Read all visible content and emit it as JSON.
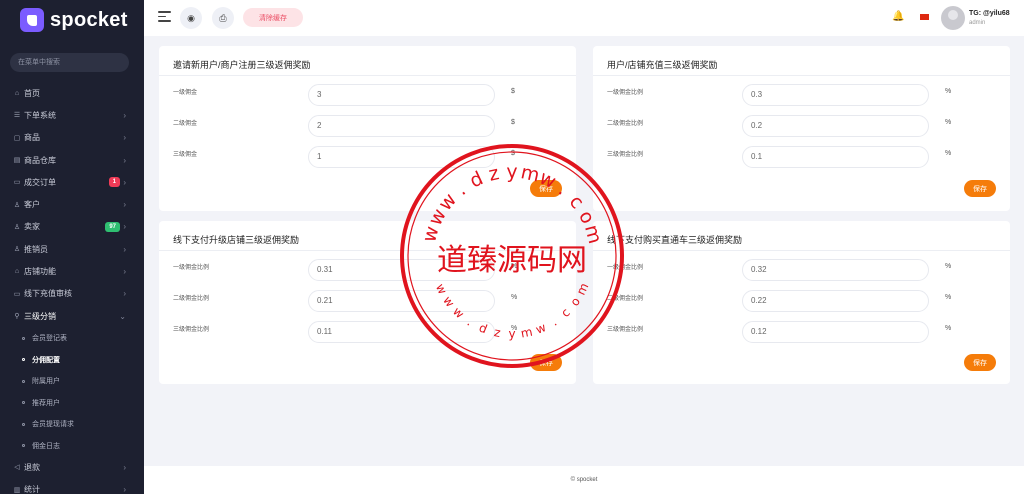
{
  "brand": {
    "name": "spocket"
  },
  "sidebar": {
    "search_placeholder": "在菜单中搜索",
    "items": [
      {
        "icon": "home-icon",
        "label": "首页",
        "chevron": false
      },
      {
        "icon": "list-icon",
        "label": "下单系统",
        "chevron": true
      },
      {
        "icon": "bag-icon",
        "label": "商品",
        "chevron": true
      },
      {
        "icon": "warehouse-icon",
        "label": "商品仓库",
        "chevron": true
      },
      {
        "icon": "order-icon",
        "label": "成交订单",
        "chevron": true,
        "badge": "1",
        "badge_color": "#ef3b57"
      },
      {
        "icon": "user-icon",
        "label": "客户",
        "chevron": true
      },
      {
        "icon": "seller-icon",
        "label": "卖家",
        "chevron": true,
        "badge": "97",
        "badge_color": "#2fbf71"
      },
      {
        "icon": "promoter-icon",
        "label": "推销员",
        "chevron": true
      },
      {
        "icon": "shop-icon",
        "label": "店铺功能",
        "chevron": true
      },
      {
        "icon": "recharge-icon",
        "label": "线下充值审核",
        "chevron": true
      },
      {
        "icon": "share-icon",
        "label": "三级分销",
        "chevron": true,
        "open": true
      }
    ],
    "subitems": [
      "会员登记表",
      "分佣配置",
      "附属用户",
      "推荐用户",
      "会员提现请求",
      "佣金日志"
    ],
    "active_sub": "分佣配置",
    "after_items": [
      {
        "icon": "refund-icon",
        "label": "退款",
        "chevron": true
      },
      {
        "icon": "stats-icon",
        "label": "统计",
        "chevron": true
      }
    ]
  },
  "topbar": {
    "clear_cache": "清除缓存",
    "user": "TG: @yilu68",
    "role": "admin"
  },
  "cards": [
    {
      "title": "邀请新用户/商户注册三级返佣奖励",
      "rows": [
        {
          "label": "一级佣金",
          "value": "3",
          "unit": "$"
        },
        {
          "label": "二级佣金",
          "value": "2",
          "unit": "$"
        },
        {
          "label": "三级佣金",
          "value": "1",
          "unit": "$"
        }
      ],
      "save": "保存"
    },
    {
      "title": "用户/店铺充值三级返佣奖励",
      "rows": [
        {
          "label": "一级佣金比例",
          "value": "0.3",
          "unit": "%"
        },
        {
          "label": "二级佣金比例",
          "value": "0.2",
          "unit": "%"
        },
        {
          "label": "三级佣金比例",
          "value": "0.1",
          "unit": "%"
        }
      ],
      "save": "保存"
    },
    {
      "title": "线下支付升级店铺三级返佣奖励",
      "rows": [
        {
          "label": "一级佣金比例",
          "value": "0.31",
          "unit": "%"
        },
        {
          "label": "二级佣金比例",
          "value": "0.21",
          "unit": "%"
        },
        {
          "label": "三级佣金比例",
          "value": "0.11",
          "unit": "%"
        }
      ],
      "save": "保存"
    },
    {
      "title": "线下支付购买直通车三级返佣奖励",
      "rows": [
        {
          "label": "一级佣金比例",
          "value": "0.32",
          "unit": "%"
        },
        {
          "label": "二级佣金比例",
          "value": "0.22",
          "unit": "%"
        },
        {
          "label": "三级佣金比例",
          "value": "0.12",
          "unit": "%"
        }
      ],
      "save": "保存"
    }
  ],
  "footer": {
    "text": "© spocket"
  },
  "watermark": {
    "main": "道臻源码网",
    "url_top": "www.dzymw.com",
    "url_bottom": "www.dzymw.com",
    "color": "#e0141e"
  }
}
